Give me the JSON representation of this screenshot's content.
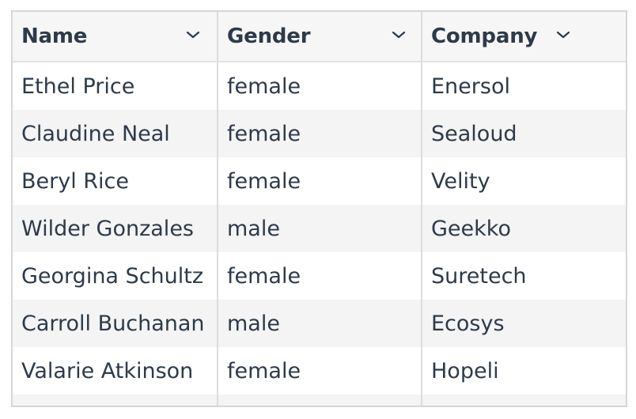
{
  "table": {
    "columns": [
      {
        "label": "Name",
        "icon": "chevron-down-icon"
      },
      {
        "label": "Gender",
        "icon": "chevron-down-icon"
      },
      {
        "label": "Company",
        "icon": "chevron-down-icon"
      }
    ],
    "rows": [
      {
        "name": "Ethel Price",
        "gender": "female",
        "company": "Enersol"
      },
      {
        "name": "Claudine Neal",
        "gender": "female",
        "company": "Sealoud"
      },
      {
        "name": "Beryl Rice",
        "gender": "female",
        "company": "Velity"
      },
      {
        "name": "Wilder Gonzales",
        "gender": "male",
        "company": "Geekko"
      },
      {
        "name": "Georgina Schultz",
        "gender": "female",
        "company": "Suretech"
      },
      {
        "name": "Carroll Buchanan",
        "gender": "male",
        "company": "Ecosys"
      },
      {
        "name": "Valarie Atkinson",
        "gender": "female",
        "company": "Hopeli"
      }
    ]
  },
  "colors": {
    "text": "#2d3a4a",
    "header_bg": "#f6f6f6",
    "alt_row_bg": "#f4f4f4",
    "border": "#d7d7d7"
  }
}
